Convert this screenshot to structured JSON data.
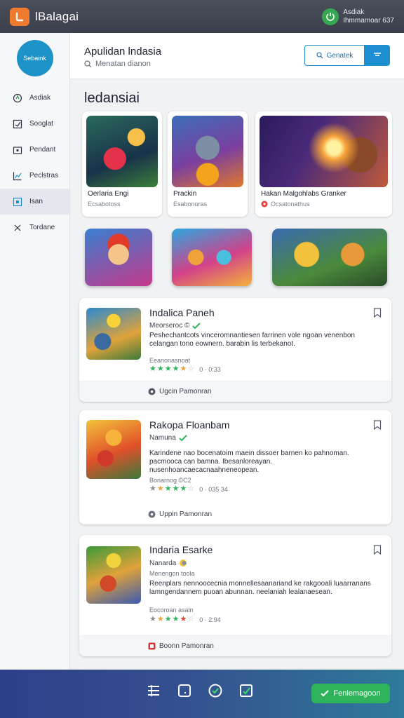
{
  "app": {
    "title": "lBalagai"
  },
  "user": {
    "line1": "Asdiak",
    "line2": "Ihmmamoar 637"
  },
  "sidebar": {
    "avatar_label": "Sebaink",
    "items": [
      {
        "label": "Asdiak",
        "icon": "compass-icon"
      },
      {
        "label": "Sooglat",
        "icon": "edit-box-icon"
      },
      {
        "label": "Pendant",
        "icon": "folder-icon"
      },
      {
        "label": "Peclstras",
        "icon": "chart-icon"
      },
      {
        "label": "Isan",
        "icon": "grid-icon"
      },
      {
        "label": "Tordane",
        "icon": "close-icon"
      }
    ]
  },
  "header": {
    "title": "Apulidan lndasia",
    "subtitle": "Menatan dianon",
    "button_label": "Genatek"
  },
  "section_title": "ledansiai",
  "featured": [
    {
      "name": "Oerlaria Engi",
      "meta": "Ecsabotoss"
    },
    {
      "name": "Prackin",
      "meta": "Esabonoras"
    },
    {
      "name": "Hakan Malgohlabs Granker",
      "meta": "Ocsatonathus"
    }
  ],
  "cards": [
    {
      "title": "Indalica Paneh",
      "subtitle": "Meorseroc ©",
      "desc": "Peshechantcots vinceromnantiesen farrinen vole ngoan venenbon celangan tono eownern. barabin lis terbekanot.",
      "tag": "Eeanonasnoat",
      "rating": "0  ·  0:33",
      "footer": "Ugcin Pamonran"
    },
    {
      "title": "Rakopa Floanbam",
      "subtitle": "Namuna",
      "desc": "Karindene nao bocenatoim maein dissoer barnen ko pahnoman. pacmooca can bamna. Ibesanloreayan. nusenhoancaecacnaahneneopean.",
      "tag": "Bonarnog ©C2",
      "rating": "0  ·  035 34",
      "footer": "Uppin Pamonran"
    },
    {
      "title": "Indaria Esarke",
      "subtitle": "Nanarda",
      "desc": "Reenplars nennoocecnia monnellesaanariand ke rakgooali luaarranans lamngendannem puoan abunnan. neelaniah lealanaesean.",
      "tag": "Menengon toola",
      "tag2": "Eocoroan asaln",
      "rating": "0  ·  2:94",
      "footer": "Boonn Pamonran"
    }
  ],
  "bottom": {
    "button_label": "Fenlemagoon"
  },
  "colors": {
    "accent": "#1d8fd0",
    "brand": "#f07a2e",
    "success": "#2fb35a"
  }
}
